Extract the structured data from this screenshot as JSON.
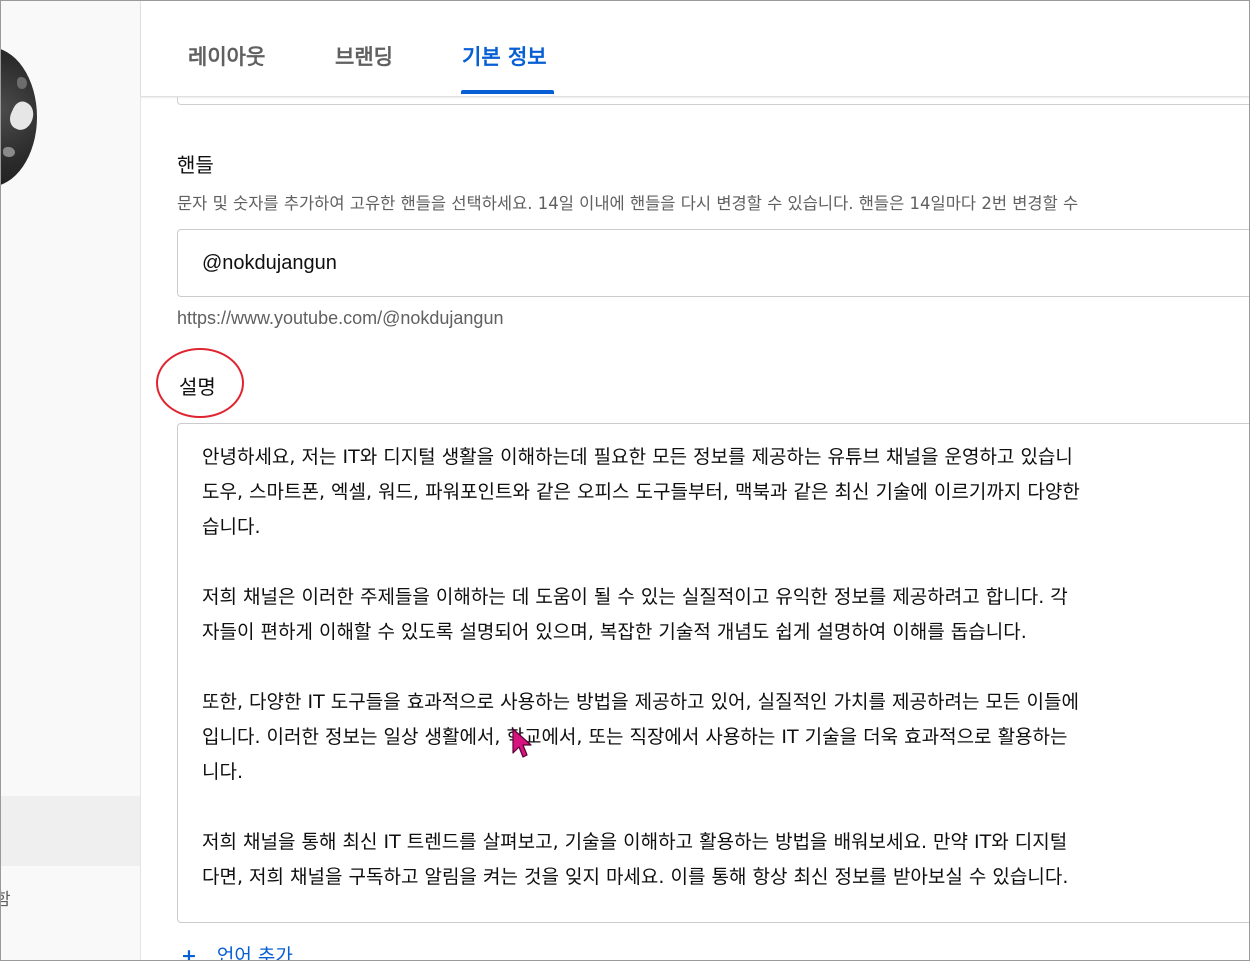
{
  "tabs": [
    {
      "label": "레이아웃",
      "active": false
    },
    {
      "label": "브랜딩",
      "active": false
    },
    {
      "label": "기본 정보",
      "active": true
    }
  ],
  "sidebar": {
    "partial_item_label": "함"
  },
  "handle": {
    "title": "핸들",
    "description": "문자 및 숫자를 추가하여 고유한 핸들을 선택하세요. 14일 이내에 핸들을 다시 변경할 수 있습니다. 핸들은 14일마다 2번 변경할 수",
    "value": "@nokdujangun",
    "url": "https://www.youtube.com/@nokdujangun"
  },
  "description": {
    "title": "설명",
    "lines": [
      "안녕하세요, 저는 IT와 디지털 생활을 이해하는데 필요한 모든 정보를 제공하는 유튜브 채널을 운영하고 있습니",
      "도우, 스마트폰, 엑셀, 워드, 파워포인트와 같은 오피스 도구들부터, 맥북과 같은 최신 기술에 이르기까지 다양한",
      "습니다.",
      "",
      "저희 채널은 이러한 주제들을 이해하는 데 도움이 될 수 있는 실질적이고 유익한 정보를 제공하려고 합니다. 각",
      "자들이 편하게 이해할 수 있도록 설명되어 있으며, 복잡한 기술적 개념도 쉽게 설명하여 이해를 돕습니다.",
      "",
      "또한, 다양한 IT 도구들을 효과적으로 사용하는 방법을 제공하고 있어, 실질적인 가치를 제공하려는 모든 이들에",
      "입니다. 이러한 정보는 일상 생활에서, 학교에서, 또는 직장에서 사용하는 IT 기술을 더욱 효과적으로 활용하는",
      "니다.",
      "",
      "저희 채널을 통해 최신 IT 트렌드를 살펴보고, 기술을 이해하고 활용하는 방법을 배워보세요. 만약 IT와 디지털",
      "다면, 저희 채널을 구독하고 알림을 켜는 것을 잊지 마세요. 이를 통해 항상 최신 정보를 받아보실 수 있습니다."
    ]
  },
  "add_language": {
    "label": "언어 추가",
    "icon": "plus-icon"
  },
  "colors": {
    "accent": "#065fd4",
    "annotation": "#e0242f",
    "cursor": "#d6137f"
  }
}
